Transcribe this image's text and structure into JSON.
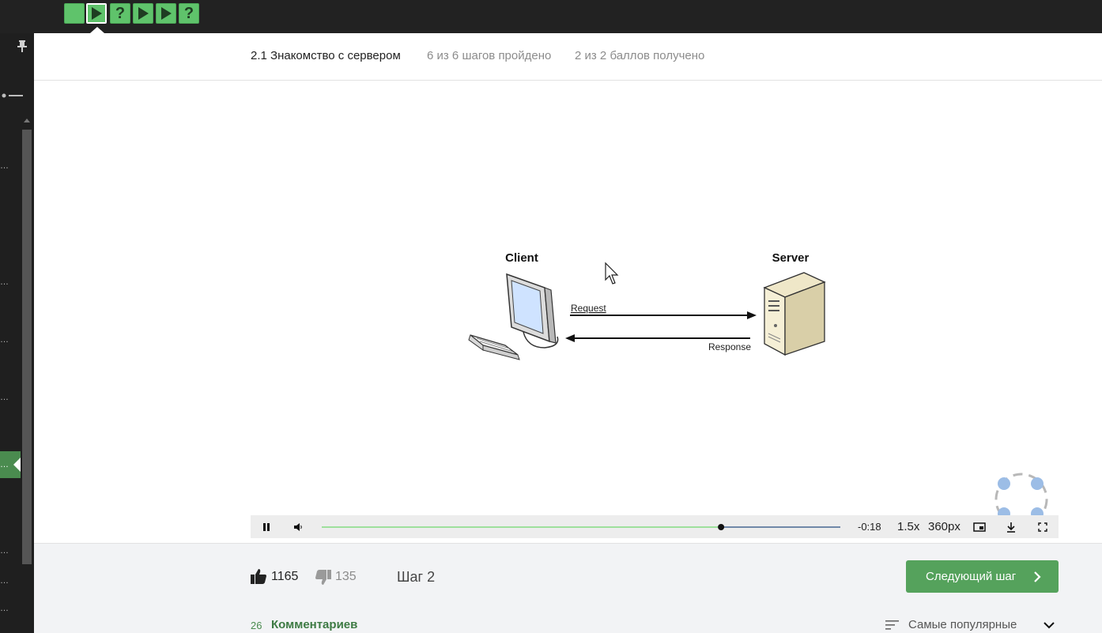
{
  "step_bar": {
    "steps": [
      {
        "type": "text",
        "glyph": ""
      },
      {
        "type": "video",
        "glyph": "play-icon",
        "active": true
      },
      {
        "type": "quiz",
        "glyph": "?"
      },
      {
        "type": "video",
        "glyph": "play-icon"
      },
      {
        "type": "video",
        "glyph": "play-icon"
      },
      {
        "type": "quiz",
        "glyph": "?"
      }
    ],
    "color": "#5fc36b"
  },
  "sidebar": {
    "dots": [
      "…",
      "…",
      "…",
      "…",
      "…",
      "…",
      "…",
      "…",
      "…"
    ]
  },
  "header": {
    "lesson_title": "2.1 Знакомство с сервером",
    "steps_progress": "6 из 6 шагов пройдено",
    "score_progress": "2 из 2 баллов  получено"
  },
  "video": {
    "diagram": {
      "client_label": "Client",
      "server_label": "Server",
      "request_label": "Request",
      "response_label": "Response"
    },
    "controls": {
      "time_remaining": "-0:18",
      "speed": "1.5x",
      "quality": "360px",
      "progress": 0.77,
      "progress_color": "#9ee09c",
      "remaining_color": "#7088a8"
    }
  },
  "footer": {
    "likes": "1165",
    "dislikes": "135",
    "step_label": "Шаг 2",
    "next_button": "Следующий шаг",
    "comments_count": "26",
    "comments_label": "Комментариев",
    "sort_label": "Самые популярные",
    "accent": "#55a25c"
  }
}
